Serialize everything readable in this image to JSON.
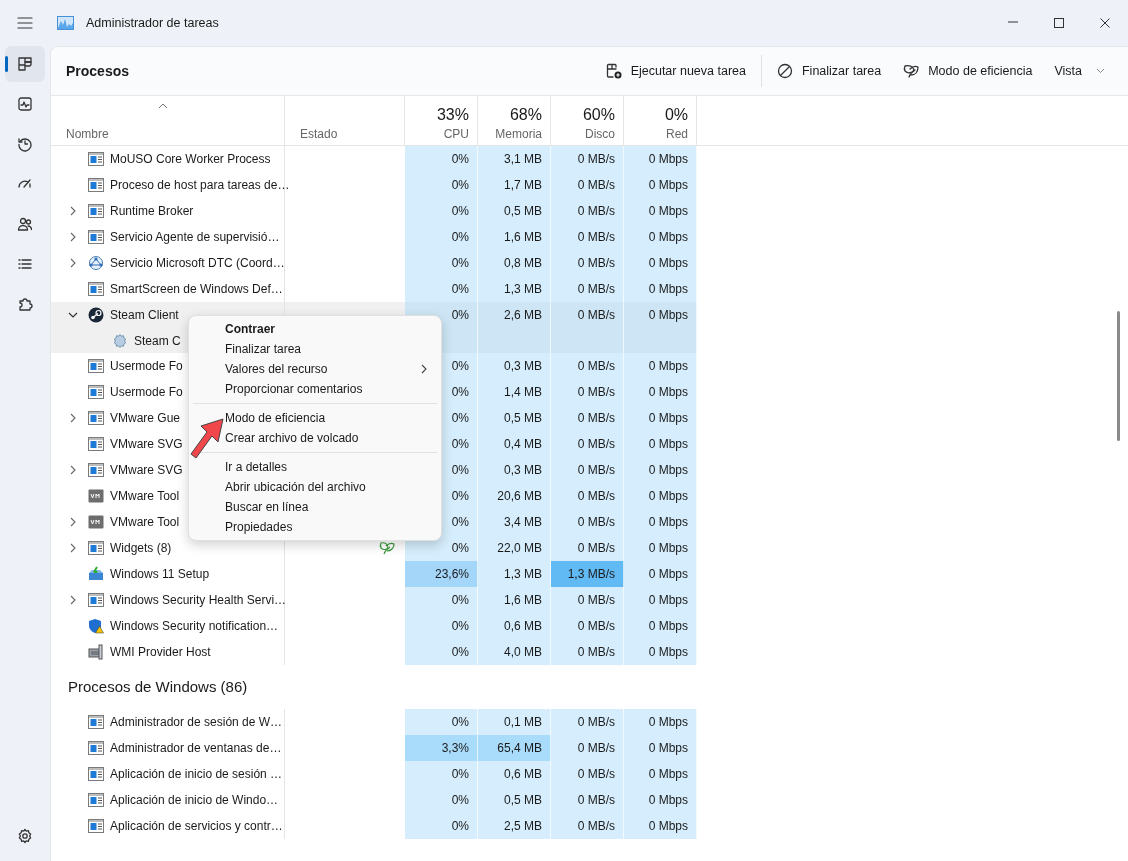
{
  "window": {
    "title": "Administrador de tareas"
  },
  "sidebar": {
    "items": [
      {
        "selected": true
      },
      {
        "selected": false
      },
      {
        "selected": false
      },
      {
        "selected": false
      },
      {
        "selected": false
      },
      {
        "selected": false
      },
      {
        "selected": false
      }
    ]
  },
  "page_title": "Procesos",
  "toolbar": [
    {
      "label": "Ejecutar nueva tarea",
      "kind": "button"
    },
    {
      "label": "Finalizar tarea",
      "kind": "button"
    },
    {
      "label": "Modo de eficiencia",
      "kind": "button"
    },
    {
      "label": "Vista",
      "kind": "dropdown"
    }
  ],
  "table": {
    "columns": [
      {
        "label": "Nombre",
        "sorted": true
      },
      {
        "label": "Estado",
        "sorted": false
      },
      {
        "label": "CPU",
        "usage": "33%",
        "sorted": false
      },
      {
        "label": "Memoria",
        "usage": "68%",
        "sorted": false
      },
      {
        "label": "Disco",
        "usage": "60%",
        "sorted": false
      },
      {
        "label": "Red",
        "usage": "0%",
        "sorted": false
      }
    ],
    "rows": [
      {
        "kind": "window",
        "name": "MoUSO Core Worker Process",
        "selected": false,
        "efficiency": false,
        "cells": [
          {
            "text": "0%",
            "color": "#d5edfc"
          },
          {
            "text": "3,1 MB",
            "color": "#d5edfc"
          },
          {
            "text": "0 MB/s",
            "color": "#d5edfc"
          },
          {
            "text": "0 Mbps",
            "color": "#d5edfc"
          }
        ]
      },
      {
        "kind": "window",
        "name": "Proceso de host para tareas de…",
        "selected": false,
        "efficiency": false,
        "cells": [
          {
            "text": "0%",
            "color": "#d5edfc"
          },
          {
            "text": "1,7 MB",
            "color": "#d5edfc"
          },
          {
            "text": "0 MB/s",
            "color": "#d5edfc"
          },
          {
            "text": "0 Mbps",
            "color": "#d5edfc"
          }
        ]
      },
      {
        "kind": "window",
        "name": "Runtime Broker",
        "expanded": false,
        "selected": false,
        "efficiency": false,
        "cells": [
          {
            "text": "0%",
            "color": "#d5edfc"
          },
          {
            "text": "0,5 MB",
            "color": "#d5edfc"
          },
          {
            "text": "0 MB/s",
            "color": "#d5edfc"
          },
          {
            "text": "0 Mbps",
            "color": "#d5edfc"
          }
        ]
      },
      {
        "kind": "window",
        "name": "Servicio Agente de supervisió…",
        "expanded": false,
        "selected": false,
        "efficiency": false,
        "cells": [
          {
            "text": "0%",
            "color": "#d5edfc"
          },
          {
            "text": "1,6 MB",
            "color": "#d5edfc"
          },
          {
            "text": "0 MB/s",
            "color": "#d5edfc"
          },
          {
            "text": "0 Mbps",
            "color": "#d5edfc"
          }
        ]
      },
      {
        "kind": "network",
        "name": "Servicio Microsoft DTC (Coord…",
        "expanded": false,
        "selected": false,
        "efficiency": false,
        "cells": [
          {
            "text": "0%",
            "color": "#d5edfc"
          },
          {
            "text": "0,8 MB",
            "color": "#d5edfc"
          },
          {
            "text": "0 MB/s",
            "color": "#d5edfc"
          },
          {
            "text": "0 Mbps",
            "color": "#d5edfc"
          }
        ]
      },
      {
        "kind": "window",
        "name": "SmartScreen de Windows Def…",
        "selected": false,
        "efficiency": false,
        "cells": [
          {
            "text": "0%",
            "color": "#d5edfc"
          },
          {
            "text": "1,3 MB",
            "color": "#d5edfc"
          },
          {
            "text": "0 MB/s",
            "color": "#d5edfc"
          },
          {
            "text": "0 Mbps",
            "color": "#d5edfc"
          }
        ]
      },
      {
        "kind": "steam",
        "name": "Steam Client",
        "expanded": true,
        "selected": true,
        "efficiency": false,
        "cells": [
          {
            "text": "0%",
            "color": "#cde5f4"
          },
          {
            "text": "2,6 MB",
            "color": "#cde5f4"
          },
          {
            "text": "0 MB/s",
            "color": "#cde5f4"
          },
          {
            "text": "0 Mbps",
            "color": "#cde5f4"
          }
        ],
        "children": [
          {
            "kind": "gear",
            "name": "Steam C",
            "selected": true,
            "cells": [
              {
                "color": "#cde5f4"
              },
              {
                "color": "#cde5f4"
              },
              {
                "color": "#cde5f4"
              },
              {
                "color": "#cde5f4"
              }
            ]
          }
        ]
      },
      {
        "kind": "window",
        "name": "Usermode Fo",
        "selected": false,
        "cells": [
          {
            "text": "0%",
            "color": "#d5edfc"
          },
          {
            "text": "0,3 MB",
            "color": "#d5edfc"
          },
          {
            "text": "0 MB/s",
            "color": "#d5edfc"
          },
          {
            "text": "0 Mbps",
            "color": "#d5edfc"
          }
        ]
      },
      {
        "kind": "window",
        "name": "Usermode Fo",
        "selected": false,
        "cells": [
          {
            "text": "0%",
            "color": "#d5edfc"
          },
          {
            "text": "1,4 MB",
            "color": "#d5edfc"
          },
          {
            "text": "0 MB/s",
            "color": "#d5edfc"
          },
          {
            "text": "0 Mbps",
            "color": "#d5edfc"
          }
        ]
      },
      {
        "kind": "window",
        "name": "VMware Gue",
        "expanded": false,
        "selected": false,
        "cells": [
          {
            "text": "0%",
            "color": "#d5edfc"
          },
          {
            "text": "0,5 MB",
            "color": "#d5edfc"
          },
          {
            "text": "0 MB/s",
            "color": "#d5edfc"
          },
          {
            "text": "0 Mbps",
            "color": "#d5edfc"
          }
        ]
      },
      {
        "kind": "window",
        "name": "VMware SVG",
        "selected": false,
        "cells": [
          {
            "text": "0%",
            "color": "#d5edfc"
          },
          {
            "text": "0,4 MB",
            "color": "#d5edfc"
          },
          {
            "text": "0 MB/s",
            "color": "#d5edfc"
          },
          {
            "text": "0 Mbps",
            "color": "#d5edfc"
          }
        ]
      },
      {
        "kind": "window",
        "name": "VMware SVG",
        "expanded": false,
        "selected": false,
        "cells": [
          {
            "text": "0%",
            "color": "#d5edfc"
          },
          {
            "text": "0,3 MB",
            "color": "#d5edfc"
          },
          {
            "text": "0 MB/s",
            "color": "#d5edfc"
          },
          {
            "text": "0 Mbps",
            "color": "#d5edfc"
          }
        ]
      },
      {
        "kind": "vm",
        "name": "VMware Tool",
        "selected": false,
        "cells": [
          {
            "text": "0%",
            "color": "#d5edfc"
          },
          {
            "text": "20,6 MB",
            "color": "#d5edfc"
          },
          {
            "text": "0 MB/s",
            "color": "#d5edfc"
          },
          {
            "text": "0 Mbps",
            "color": "#d5edfc"
          }
        ]
      },
      {
        "kind": "vm",
        "name": "VMware Tool",
        "expanded": false,
        "selected": false,
        "cells": [
          {
            "text": "0%",
            "color": "#d5edfc"
          },
          {
            "text": "3,4 MB",
            "color": "#d5edfc"
          },
          {
            "text": "0 MB/s",
            "color": "#d5edfc"
          },
          {
            "text": "0 Mbps",
            "color": "#d5edfc"
          }
        ]
      },
      {
        "kind": "window",
        "name": "Widgets (8)",
        "expanded": false,
        "selected": false,
        "efficiency": true,
        "cells": [
          {
            "text": "0%",
            "color": "#d5edfc"
          },
          {
            "text": "22,0 MB",
            "color": "#d5edfc"
          },
          {
            "text": "0 MB/s",
            "color": "#d5edfc"
          },
          {
            "text": "0 Mbps",
            "color": "#d5edfc"
          }
        ]
      },
      {
        "kind": "setup",
        "name": "Windows 11 Setup",
        "selected": false,
        "efficiency": false,
        "cells": [
          {
            "text": "23,6%",
            "color": "#a3d6f9"
          },
          {
            "text": "1,3 MB",
            "color": "#d5edfc"
          },
          {
            "text": "1,3 MB/s",
            "color": "#62baf4"
          },
          {
            "text": "0 Mbps",
            "color": "#d5edfc"
          }
        ]
      },
      {
        "kind": "window",
        "name": "Windows Security Health Servi…",
        "expanded": false,
        "selected": false,
        "efficiency": false,
        "cells": [
          {
            "text": "0%",
            "color": "#d5edfc"
          },
          {
            "text": "1,6 MB",
            "color": "#d5edfc"
          },
          {
            "text": "0 MB/s",
            "color": "#d5edfc"
          },
          {
            "text": "0 Mbps",
            "color": "#d5edfc"
          }
        ]
      },
      {
        "kind": "shield",
        "name": "Windows Security notification…",
        "selected": false,
        "efficiency": false,
        "cells": [
          {
            "text": "0%",
            "color": "#d5edfc"
          },
          {
            "text": "0,6 MB",
            "color": "#d5edfc"
          },
          {
            "text": "0 MB/s",
            "color": "#d5edfc"
          },
          {
            "text": "0 Mbps",
            "color": "#d5edfc"
          }
        ]
      },
      {
        "kind": "wmi",
        "name": "WMI Provider Host",
        "selected": false,
        "efficiency": false,
        "cells": [
          {
            "text": "0%",
            "color": "#d5edfc"
          },
          {
            "text": "4,0 MB",
            "color": "#d5edfc"
          },
          {
            "text": "0 MB/s",
            "color": "#d5edfc"
          },
          {
            "text": "0 Mbps",
            "color": "#d5edfc"
          }
        ]
      },
      {
        "kind": "group",
        "name": "Procesos de Windows (86)"
      },
      {
        "kind": "window",
        "name": "Administrador de sesión de W…",
        "selected": false,
        "efficiency": false,
        "cells": [
          {
            "text": "0%",
            "color": "#d5edfc"
          },
          {
            "text": "0,1 MB",
            "color": "#d5edfc"
          },
          {
            "text": "0 MB/s",
            "color": "#d5edfc"
          },
          {
            "text": "0 Mbps",
            "color": "#d5edfc"
          }
        ]
      },
      {
        "kind": "window",
        "name": "Administrador de ventanas de…",
        "selected": false,
        "efficiency": false,
        "cells": [
          {
            "text": "3,3%",
            "color": "#a9dbfa"
          },
          {
            "text": "65,4 MB",
            "color": "#a9dbfa"
          },
          {
            "text": "0 MB/s",
            "color": "#d5edfc"
          },
          {
            "text": "0 Mbps",
            "color": "#d5edfc"
          }
        ]
      },
      {
        "kind": "window",
        "name": "Aplicación de inicio de sesión …",
        "selected": false,
        "efficiency": false,
        "cells": [
          {
            "text": "0%",
            "color": "#d5edfc"
          },
          {
            "text": "0,6 MB",
            "color": "#d5edfc"
          },
          {
            "text": "0 MB/s",
            "color": "#d5edfc"
          },
          {
            "text": "0 Mbps",
            "color": "#d5edfc"
          }
        ]
      },
      {
        "kind": "window",
        "name": "Aplicación de inicio de Windo…",
        "selected": false,
        "efficiency": false,
        "cells": [
          {
            "text": "0%",
            "color": "#d5edfc"
          },
          {
            "text": "0,5 MB",
            "color": "#d5edfc"
          },
          {
            "text": "0 MB/s",
            "color": "#d5edfc"
          },
          {
            "text": "0 Mbps",
            "color": "#d5edfc"
          }
        ]
      },
      {
        "kind": "window",
        "name": "Aplicación de servicios y contr…",
        "selected": false,
        "efficiency": false,
        "cells": [
          {
            "text": "0%",
            "color": "#d5edfc"
          },
          {
            "text": "2,5 MB",
            "color": "#d5edfc"
          },
          {
            "text": "0 MB/s",
            "color": "#d5edfc"
          },
          {
            "text": "0 Mbps",
            "color": "#d5edfc"
          }
        ]
      }
    ]
  },
  "context_menu": {
    "sections": [
      [
        {
          "label": "Contraer",
          "default": true,
          "submenu": false
        },
        {
          "label": "Finalizar tarea",
          "default": false,
          "submenu": false
        },
        {
          "label": "Valores del recurso",
          "default": false,
          "submenu": true
        },
        {
          "label": "Proporcionar comentarios",
          "default": false,
          "submenu": false
        }
      ],
      [
        {
          "label": "Modo de eficiencia",
          "default": false,
          "submenu": false
        },
        {
          "label": "Crear archivo de volcado",
          "default": false,
          "submenu": false
        }
      ],
      [
        {
          "label": "Ir a detalles",
          "default": false,
          "submenu": false
        },
        {
          "label": "Abrir ubicación del archivo",
          "default": false,
          "submenu": false
        },
        {
          "label": "Buscar en línea",
          "default": false,
          "submenu": false
        },
        {
          "label": "Propiedades",
          "default": false,
          "submenu": false
        }
      ]
    ]
  }
}
